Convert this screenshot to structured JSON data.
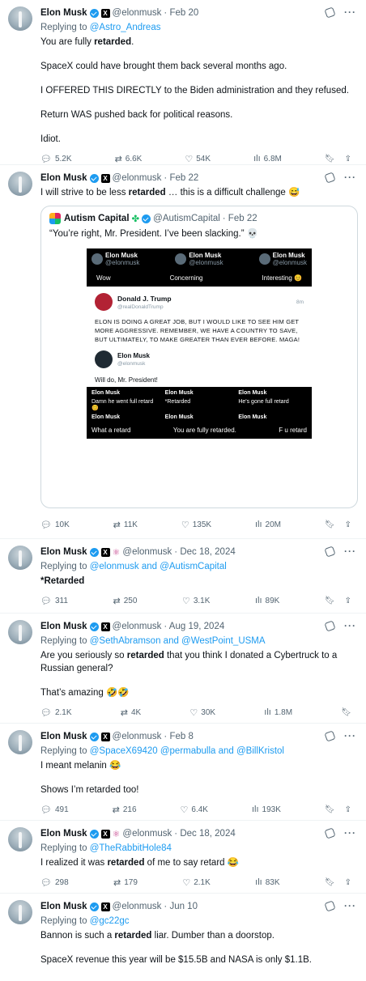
{
  "tweets": [
    {
      "name": "Elon Musk",
      "handle": "@elonmusk",
      "date": "· Feb 20",
      "affiliate": false,
      "replying_prefix": "Replying to ",
      "replying_to": "@Astro_Andreas",
      "paragraphs": [
        {
          "pre": "You are fully ",
          "bold": "retarded",
          "post": "."
        },
        {
          "pre": "SpaceX could have brought them back several months ago.",
          "bold": "",
          "post": ""
        },
        {
          "pre": "I OFFERED THIS DIRECTLY to the Biden administration and they refused.",
          "bold": "",
          "post": ""
        },
        {
          "pre": "Return WAS pushed back for political reasons.",
          "bold": "",
          "post": ""
        },
        {
          "pre": "Idiot.",
          "bold": "",
          "post": ""
        }
      ],
      "replies": "5.2K",
      "reposts": "6.6K",
      "likes": "54K",
      "views": "6.8M"
    },
    {
      "name": "Elon Musk",
      "handle": "@elonmusk",
      "date": "· Feb 22",
      "text_pre": "I will strive to be less ",
      "text_bold": "retarded",
      "text_post": " … this is a difficult challenge 😅",
      "quote": {
        "name": "Autism Capital",
        "handle": "@AutismCapital",
        "date": "· Feb 22",
        "text": "“You’re right, Mr. President. I’ve been slacking.” 💀",
        "meme": {
          "top_users": [
            "Elon Musk",
            "Elon Musk",
            "Elon Musk"
          ],
          "top_handle": "@elonmusk",
          "top_labels": [
            "Wow",
            "Concerning",
            "Interesting 😊"
          ],
          "trump_name": "Donald J. Trump",
          "trump_handle": "@realDonaldTrump",
          "trump_time": "8m",
          "trump_text": "ELON IS DOING A GREAT JOB, BUT I WOULD LIKE TO SEE HIM GET MORE AGGRESSIVE. REMEMBER, WE HAVE A COUNTRY TO SAVE, BUT ULTIMATELY, TO MAKE GREATER THAN EVER BEFORE. MAGA!",
          "elon_name": "Elon Musk",
          "elon_handle": "@elonmusk",
          "will_do": "Will do, Mr. President!",
          "grid_names": [
            "Elon Musk",
            "Elon Musk",
            "Elon Musk",
            "Elon Musk",
            "Elon Musk",
            "Elon Musk"
          ],
          "grid_mid": [
            "Damn he went full retard 😊",
            "*Retarded",
            "He's gone full retard"
          ],
          "bottom": [
            "What a retard",
            "You are fully retarded.",
            "F u retard"
          ]
        }
      },
      "replies": "10K",
      "reposts": "11K",
      "likes": "135K",
      "views": "20M"
    },
    {
      "name": "Elon Musk",
      "handle": "@elonmusk",
      "date": "· Dec 18, 2024",
      "replying_prefix": "Replying to ",
      "replying_to": "@elonmusk and @AutismCapital",
      "bold_only": "*Retarded",
      "replies": "311",
      "reposts": "250",
      "likes": "3.1K",
      "views": "89K"
    },
    {
      "name": "Elon Musk",
      "handle": "@elonmusk",
      "date": "· Aug 19, 2024",
      "replying_prefix": "Replying to ",
      "replying_to": "@SethAbramson and @WestPoint_USMA",
      "p1_pre": "Are you seriously so ",
      "p1_bold": "retarded",
      "p1_post": " that you think I donated a Cybertruck to a Russian general?",
      "p2": "That’s amazing 🤣🤣",
      "replies": "2.1K",
      "reposts": "4K",
      "likes": "30K",
      "views": "1.8M"
    },
    {
      "name": "Elon Musk",
      "handle": "@elonmusk",
      "date": "· Feb 8",
      "replying_prefix": "Replying to ",
      "replying_to": "@SpaceX69420 @permabulla and @BillKristol",
      "p1": "I meant melanin 😂",
      "p2": "Shows I’m retarded too!",
      "replies": "491",
      "reposts": "216",
      "likes": "6.4K",
      "views": "193K"
    },
    {
      "name": "Elon Musk",
      "handle": "@elonmusk",
      "date": "· Dec 18, 2024",
      "replying_prefix": "Replying to ",
      "replying_to": "@TheRabbitHole84",
      "p1_pre": "I realized it was ",
      "p1_bold": "retarded",
      "p1_post": " of me to say retard 😂",
      "replies": "298",
      "reposts": "179",
      "likes": "2.1K",
      "views": "83K"
    },
    {
      "name": "Elon Musk",
      "handle": "@elonmusk",
      "date": "· Jun 10",
      "replying_prefix": "Replying to ",
      "replying_to": "@gc22gc",
      "p1_pre": "Bannon is such a ",
      "p1_bold": "retarded",
      "p1_post": " liar. Dumber than a doorstop.",
      "p2": "SpaceX revenue this year will be $15.5B and NASA is only $1.1B."
    }
  ]
}
